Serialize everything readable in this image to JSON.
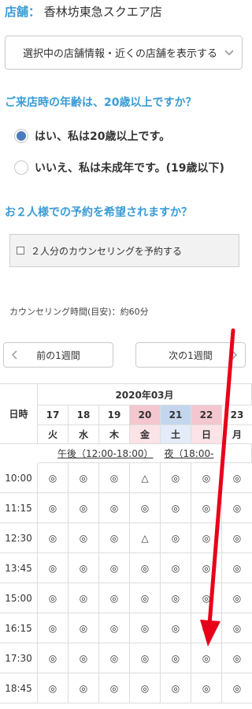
{
  "store": {
    "label": "店舗：",
    "name": "香林坊東急スクエア店"
  },
  "store_select": {
    "value": "選択中の店舗情報・近くの店舗を表示する"
  },
  "age_question": {
    "title": "ご来店時の年齢は、20歳以上ですか？",
    "options": [
      {
        "label": "はい、私は20歳以上です。",
        "selected": true
      },
      {
        "label": "いいえ、私は未成年です。(19歳以下)",
        "selected": false
      }
    ]
  },
  "pair_question": {
    "title": "お２人様での予約を希望されますか？",
    "checkbox_label": "２人分のカウンセリングを予約する"
  },
  "duration": "カウンセリング時間(目安)：約60分",
  "week_nav": {
    "prev": "前の1週間",
    "next": "次の1週間"
  },
  "calendar": {
    "header_label": "日時",
    "month": "2020年03月",
    "days": [
      {
        "num": "17",
        "wd": "火",
        "type": "normal"
      },
      {
        "num": "18",
        "wd": "水",
        "type": "normal"
      },
      {
        "num": "19",
        "wd": "木",
        "type": "normal"
      },
      {
        "num": "20",
        "wd": "金",
        "type": "holiday"
      },
      {
        "num": "21",
        "wd": "土",
        "type": "saturday"
      },
      {
        "num": "22",
        "wd": "日",
        "type": "holiday"
      },
      {
        "num": "23",
        "wd": "月",
        "type": "normal"
      }
    ],
    "periods": [
      "午後（12:00-18:00）",
      "夜（18:00-"
    ],
    "rows": [
      {
        "time": "10:00",
        "slots": [
          "◎",
          "◎",
          "◎",
          "△",
          "◎",
          "◎",
          "◎"
        ]
      },
      {
        "time": "11:15",
        "slots": [
          "◎",
          "◎",
          "◎",
          "◎",
          "◎",
          "◎",
          "◎"
        ]
      },
      {
        "time": "12:30",
        "slots": [
          "◎",
          "◎",
          "◎",
          "△",
          "◎",
          "◎",
          "◎"
        ]
      },
      {
        "time": "13:45",
        "slots": [
          "◎",
          "◎",
          "◎",
          "◎",
          "◎",
          "◎",
          "◎"
        ]
      },
      {
        "time": "15:00",
        "slots": [
          "◎",
          "◎",
          "◎",
          "◎",
          "◎",
          "◎",
          "◎"
        ]
      },
      {
        "time": "16:15",
        "slots": [
          "◎",
          "◎",
          "◎",
          "◎",
          "◎",
          "◎",
          "◎"
        ]
      },
      {
        "time": "17:30",
        "slots": [
          "◎",
          "◎",
          "◎",
          "◎",
          "◎",
          "◎",
          "◎"
        ]
      },
      {
        "time": "18:45",
        "slots": [
          "◎",
          "◎",
          "◎",
          "◎",
          "◎",
          "◎",
          "◎"
        ]
      }
    ]
  },
  "colors": {
    "accent": "#3a9bd5",
    "holiday_bg": "#f4c6cf",
    "holiday_light": "#fbe3e8",
    "saturday_bg": "#c4d6ee",
    "saturday_light": "#e3ecf8",
    "mark": "#d13a4a",
    "arrow": "#e8001a"
  }
}
